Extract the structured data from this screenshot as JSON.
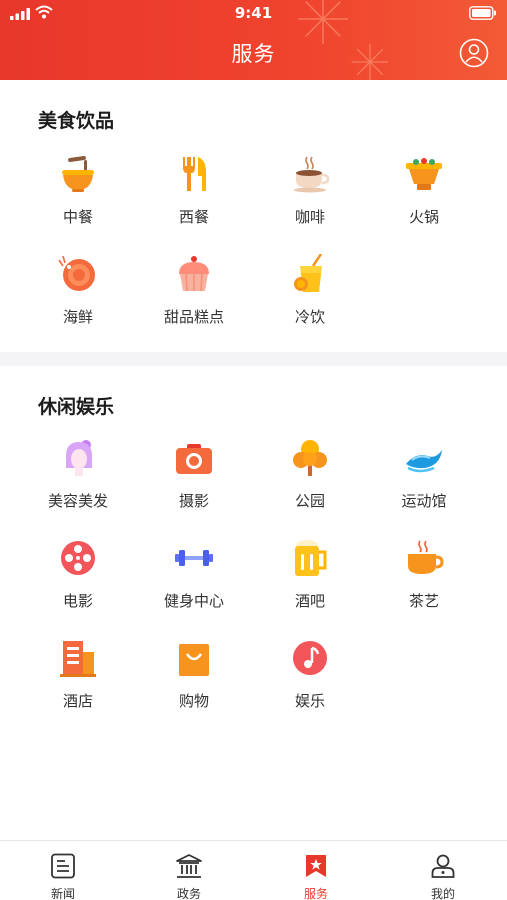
{
  "status_bar": {
    "time": "9:41"
  },
  "header": {
    "title": "服务"
  },
  "sections": [
    {
      "title": "美食饮品",
      "items": [
        {
          "label": "中餐",
          "icon": "noodle-bowl-icon"
        },
        {
          "label": "西餐",
          "icon": "fork-knife-icon"
        },
        {
          "label": "咖啡",
          "icon": "coffee-cup-icon"
        },
        {
          "label": "火锅",
          "icon": "hotpot-icon"
        },
        {
          "label": "海鲜",
          "icon": "shrimp-icon"
        },
        {
          "label": "甜品糕点",
          "icon": "cupcake-icon"
        },
        {
          "label": "冷饮",
          "icon": "cold-drink-icon"
        }
      ]
    },
    {
      "title": "休闲娱乐",
      "items": [
        {
          "label": "美容美发",
          "icon": "beauty-hair-icon"
        },
        {
          "label": "摄影",
          "icon": "camera-icon"
        },
        {
          "label": "公园",
          "icon": "tree-icon"
        },
        {
          "label": "运动馆",
          "icon": "wave-icon"
        },
        {
          "label": "电影",
          "icon": "film-reel-icon"
        },
        {
          "label": "健身中心",
          "icon": "dumbbell-icon"
        },
        {
          "label": "酒吧",
          "icon": "beer-mug-icon"
        },
        {
          "label": "茶艺",
          "icon": "tea-cup-icon"
        },
        {
          "label": "酒店",
          "icon": "hotel-building-icon"
        },
        {
          "label": "购物",
          "icon": "shopping-bag-icon"
        },
        {
          "label": "娱乐",
          "icon": "music-note-icon"
        }
      ]
    }
  ],
  "tabbar": {
    "active_index": 2,
    "tabs": [
      {
        "label": "新闻",
        "icon": "news-icon"
      },
      {
        "label": "政务",
        "icon": "government-building-icon"
      },
      {
        "label": "服务",
        "icon": "service-flag-icon"
      },
      {
        "label": "我的",
        "icon": "profile-icon"
      }
    ]
  },
  "colors": {
    "brand_red": "#e8372b",
    "accent_orange": "#f7941d",
    "tab_text": "#333333",
    "background": "#ffffff",
    "divider": "#f4f4f6"
  }
}
